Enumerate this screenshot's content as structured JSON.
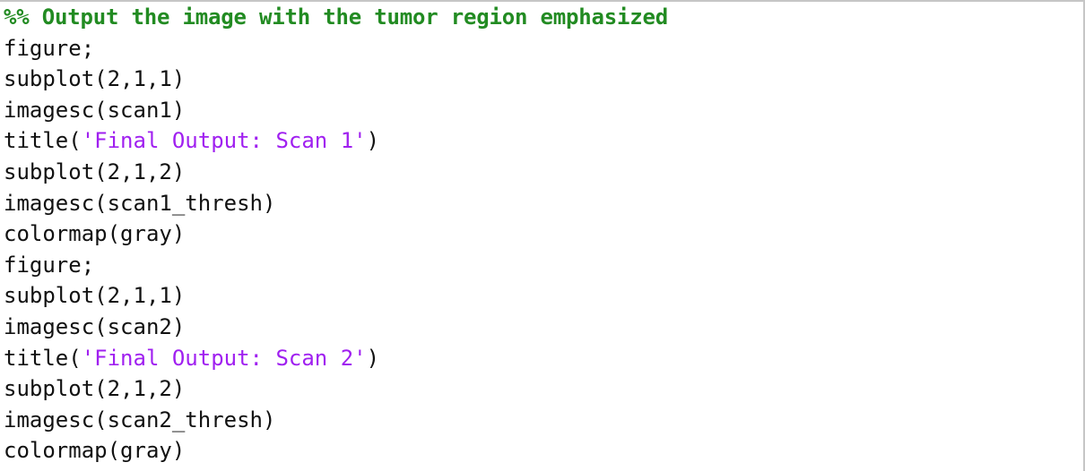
{
  "editor": {
    "language": "matlab",
    "background_color": "#ffffff",
    "border_color": "#c6c6c6",
    "colors": {
      "plain_text": "#111111",
      "comment": "#228B22",
      "string": "#A020F0"
    },
    "lines": [
      {
        "number": 1,
        "kind": "comment",
        "text": "%% Output the image with the tumor region emphasized"
      },
      {
        "number": 2,
        "kind": "plain",
        "text": "figure;"
      },
      {
        "number": 3,
        "kind": "plain",
        "text": "subplot(2,1,1)"
      },
      {
        "number": 4,
        "kind": "plain",
        "text": "imagesc(scan1)"
      },
      {
        "number": 5,
        "kind": "mixed",
        "prefix": "title(",
        "string": "'Final Output: Scan 1'",
        "suffix": ")"
      },
      {
        "number": 6,
        "kind": "plain",
        "text": "subplot(2,1,2)"
      },
      {
        "number": 7,
        "kind": "plain",
        "text": "imagesc(scan1_thresh)"
      },
      {
        "number": 8,
        "kind": "plain",
        "text": "colormap(gray)"
      },
      {
        "number": 9,
        "kind": "plain",
        "text": "figure;"
      },
      {
        "number": 10,
        "kind": "plain",
        "text": "subplot(2,1,1)"
      },
      {
        "number": 11,
        "kind": "plain",
        "text": "imagesc(scan2)"
      },
      {
        "number": 12,
        "kind": "mixed",
        "prefix": "title(",
        "string": "'Final Output: Scan 2'",
        "suffix": ")"
      },
      {
        "number": 13,
        "kind": "plain",
        "text": "subplot(2,1,2)"
      },
      {
        "number": 14,
        "kind": "plain",
        "text": "imagesc(scan2_thresh)"
      },
      {
        "number": 15,
        "kind": "plain",
        "text": "colormap(gray)"
      }
    ]
  }
}
